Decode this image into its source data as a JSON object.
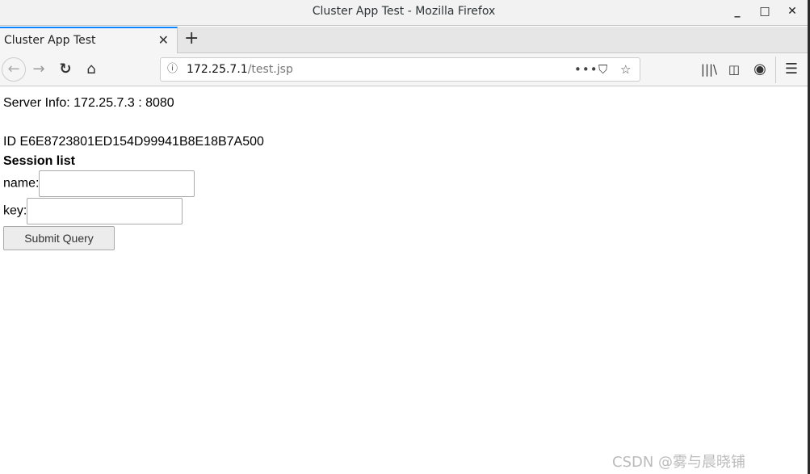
{
  "window": {
    "title": "Cluster App Test - Mozilla Firefox"
  },
  "tabs": [
    {
      "label": "Cluster App Test",
      "active": true
    }
  ],
  "address_bar": {
    "host": "172.25.7.1",
    "path": "/test.jsp"
  },
  "page": {
    "server_info": "Server Info: 172.25.7.3 : 8080",
    "session_id": "ID E6E8723801ED154D99941B8E18B7A500",
    "session_list_label": "Session list",
    "name_label": "name:",
    "name_value": "",
    "key_label": "key:",
    "key_value": "",
    "submit_label": "Submit Query"
  },
  "watermark": "CSDN @雾与晨晓铺",
  "colors": {
    "accent": "#0a84ff"
  }
}
